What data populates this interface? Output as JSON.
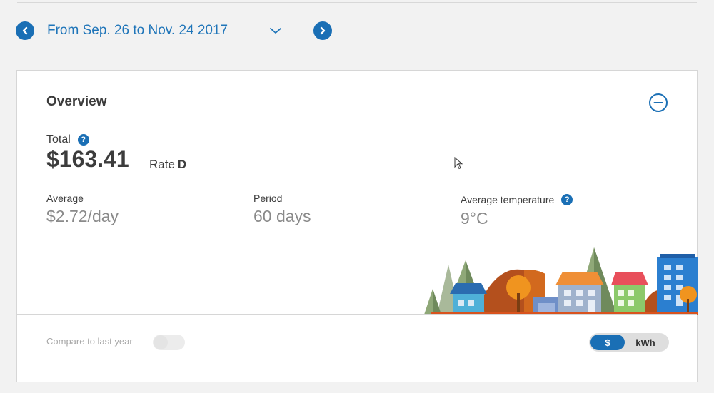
{
  "period": {
    "label": "From Sep. 26 to Nov. 24 2017",
    "prev_icon": "chevron-left-icon",
    "next_icon": "chevron-right-icon",
    "dropdown_icon": "chevron-down-icon"
  },
  "overview": {
    "title": "Overview",
    "total_label": "Total",
    "total_value": "$163.41",
    "rate_label": "Rate",
    "rate_value": "D",
    "help_glyph": "?",
    "average_label": "Average",
    "average_value": "$2.72/day",
    "period_label": "Period",
    "period_value": "60 days",
    "temp_label": "Average temperature",
    "temp_value": "9°C",
    "compare_label": "Compare to last year",
    "compare_on": false,
    "units": {
      "dollar": "$",
      "kwh": "kWh",
      "selected": "$"
    }
  },
  "colors": {
    "accent": "#1a6fb5",
    "link": "#1f75b9"
  }
}
